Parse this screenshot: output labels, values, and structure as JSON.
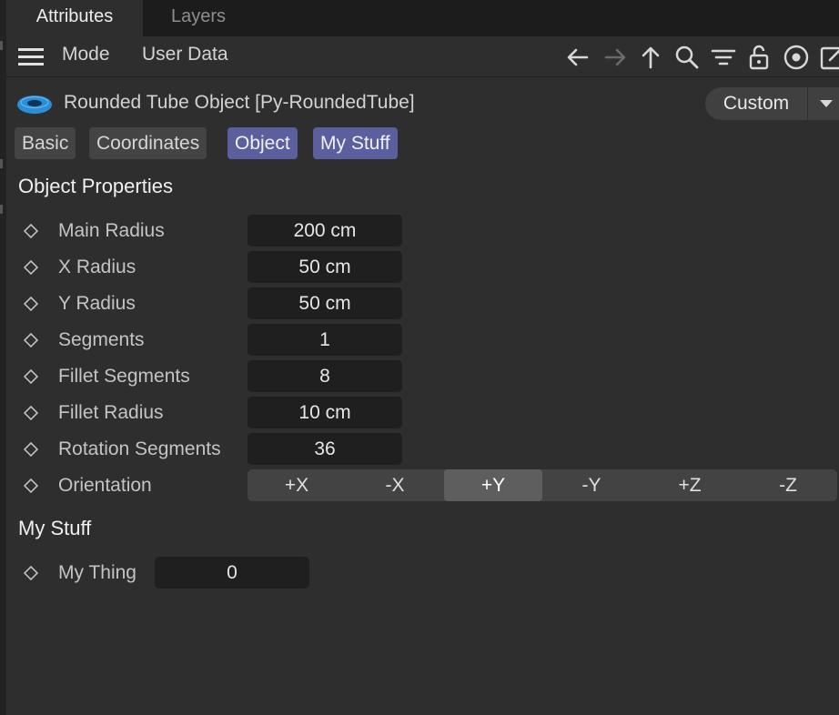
{
  "tabs": [
    {
      "label": "Attributes",
      "active": true
    },
    {
      "label": "Layers",
      "active": false
    }
  ],
  "toolbar": {
    "menu_items": [
      "Mode",
      "User Data"
    ],
    "icons": [
      "arrow-left-icon",
      "arrow-right-icon",
      "arrow-up-icon",
      "search-icon",
      "filter-icon",
      "lock-icon",
      "target-icon",
      "edit-icon"
    ]
  },
  "object": {
    "title": "Rounded Tube Object [Py-RoundedTube]",
    "icon": "torus-icon",
    "preset_label": "Custom"
  },
  "section_tabs": [
    {
      "label": "Basic",
      "active": false
    },
    {
      "label": "Coordinates",
      "active": false
    },
    {
      "label": "Object",
      "active": true
    },
    {
      "label": "My Stuff",
      "active": true
    }
  ],
  "object_properties": {
    "title": "Object Properties",
    "params": [
      {
        "label": "Main Radius",
        "value": "200 cm"
      },
      {
        "label": "X Radius",
        "value": "50 cm"
      },
      {
        "label": "Y Radius",
        "value": "50 cm"
      },
      {
        "label": "Segments",
        "value": "1"
      },
      {
        "label": "Fillet Segments",
        "value": "8"
      },
      {
        "label": "Fillet Radius",
        "value": "10 cm"
      },
      {
        "label": "Rotation Segments",
        "value": "36"
      }
    ],
    "orientation": {
      "label": "Orientation",
      "options": [
        "+X",
        "-X",
        "+Y",
        "-Y",
        "+Z",
        "-Z"
      ],
      "selected": "+Y"
    }
  },
  "my_stuff": {
    "title": "My Stuff",
    "params": [
      {
        "label": "My Thing",
        "value": "0"
      }
    ]
  },
  "colors": {
    "background": "#2e2e2e",
    "tabbar": "#1c1c1c",
    "field": "#1f1f1f",
    "accent_tab": "#5b5f9e",
    "icon_blue": "#2b8fd8"
  }
}
